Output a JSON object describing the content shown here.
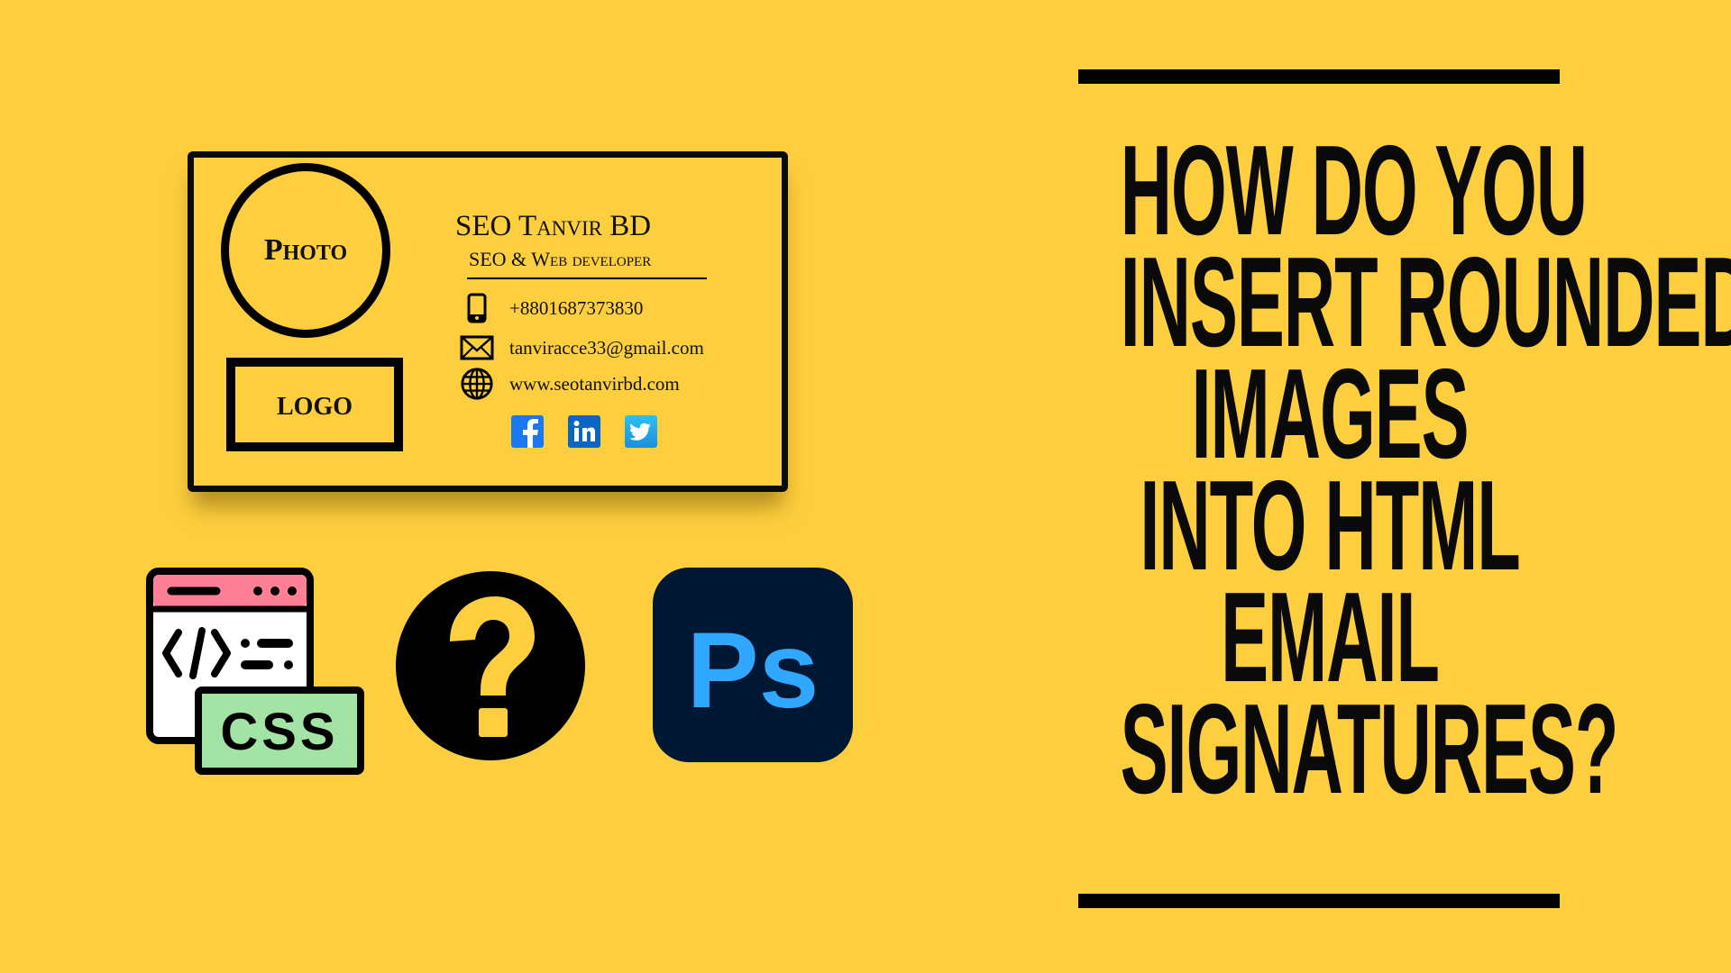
{
  "background_color": "#FDCE3E",
  "signature_card": {
    "photo_label": "Photo",
    "logo_label": "LOGO",
    "name": "SEO Tanvir BD",
    "role": "SEO & Web developer",
    "contacts": [
      {
        "icon": "phone-icon",
        "text": "+8801687373830"
      },
      {
        "icon": "envelope-icon",
        "text": "tanviracce33@gmail.com"
      },
      {
        "icon": "globe-icon",
        "text": "www.seotanvirbd.com"
      }
    ],
    "social": [
      {
        "icon": "facebook-icon",
        "label": "f",
        "color": "#1877F2"
      },
      {
        "icon": "linkedin-icon",
        "label": "in",
        "color": "#0A66C2"
      },
      {
        "icon": "twitter-icon",
        "label": "",
        "color": "#1DA1F2"
      }
    ]
  },
  "bottom_icons": {
    "css_badge": "CSS",
    "code_symbol": "</>",
    "question_mark": "?",
    "photoshop_label": "Ps",
    "colors": {
      "css_green": "#A3E4A6",
      "browser_pink": "#FF8096",
      "ps_bg": "#001834",
      "ps_blue": "#31A8FF"
    }
  },
  "heading": {
    "lines": [
      "HOW DO YOU",
      "INSERT ROUNDED",
      "IMAGES",
      "INTO HTML",
      "EMAIL",
      "SIGNATURES?"
    ]
  }
}
